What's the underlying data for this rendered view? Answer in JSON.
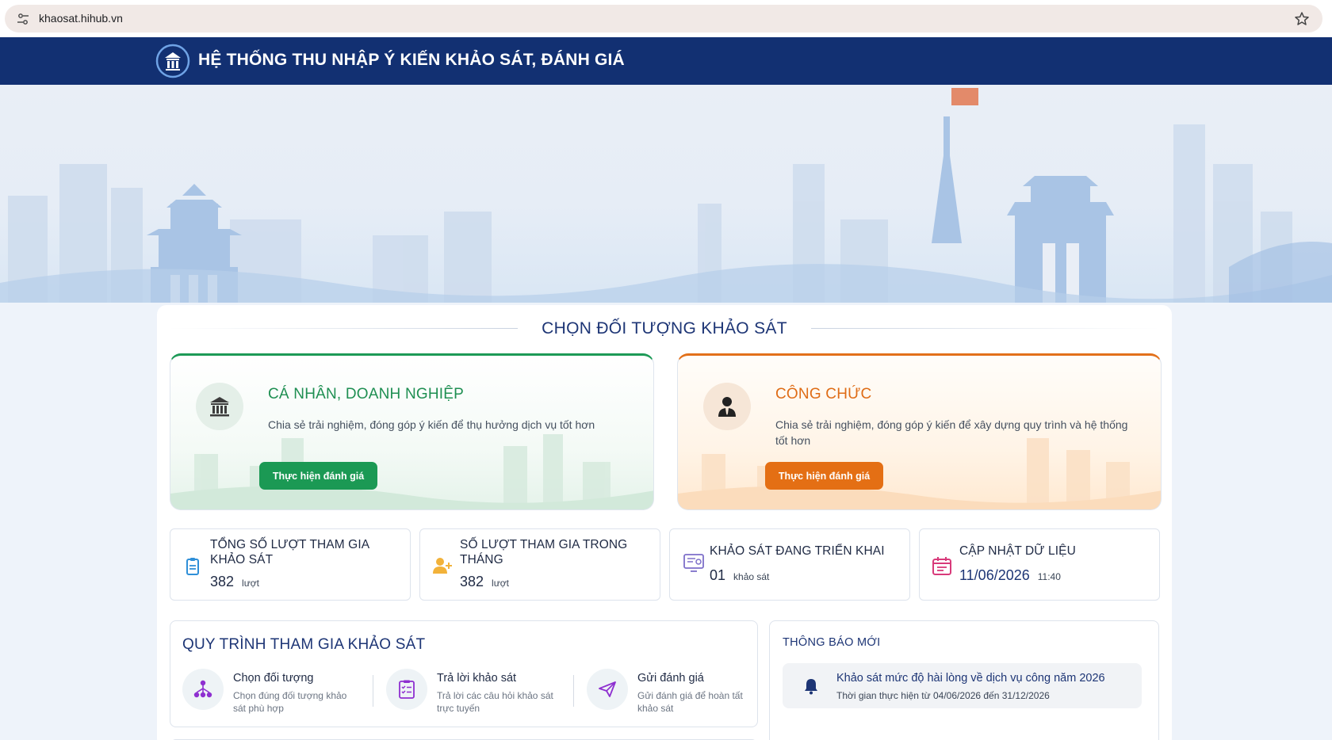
{
  "browser": {
    "url": "khaosat.hihub.vn"
  },
  "header": {
    "title": "HỆ THỐNG THU NHẬP Ý KIẾN KHẢO SÁT, ĐÁNH GIÁ"
  },
  "section": {
    "title": "CHỌN ĐỐI TƯỢNG KHẢO SÁT"
  },
  "targets": [
    {
      "title": "CÁ NHÂN, DOANH NGHIỆP",
      "description": "Chia sẻ trải nghiệm, đóng góp ý kiến để thụ hưởng dịch vụ tốt hơn",
      "button": "Thực hiện đánh giá",
      "icon": "bank-icon",
      "accent": "#1b9954"
    },
    {
      "title": "CÔNG CHỨC",
      "description": "Chia sẻ trải nghiệm, đóng góp ý kiến để xây dựng quy trình và hệ thống tốt hơn",
      "button": "Thực hiện đánh giá",
      "icon": "user-tie-icon",
      "accent": "#e46f14"
    }
  ],
  "stats": [
    {
      "title": "TỔNG SỐ LƯỢT THAM GIA KHẢO SÁT",
      "value": "382",
      "unit": "lượt",
      "icon": "clipboard-icon",
      "color": "#2f8fd8"
    },
    {
      "title": "SỐ LƯỢT THAM GIA TRONG THÁNG",
      "value": "382",
      "unit": "lượt",
      "icon": "user-plus-icon",
      "color": "#f2b23a"
    },
    {
      "title": "KHẢO SÁT ĐANG TRIỂN KHAI",
      "value": "01",
      "unit": "khảo sát",
      "icon": "survey-monitor-icon",
      "color": "#7d6fc9"
    },
    {
      "title": "CẬP NHẬT DỮ LIỆU",
      "value": "11/06/2026",
      "unit": "11:40",
      "icon": "calendar-icon",
      "color": "#d83a7a"
    }
  ],
  "process": {
    "title": "QUY TRÌNH THAM GIA KHẢO SÁT",
    "steps": [
      {
        "title": "Chọn đối tượng",
        "description": "Chọn đúng đối tượng khảo sát phù hợp",
        "icon": "network-icon",
        "color": "#8e2fd0"
      },
      {
        "title": "Trả lời khảo sát",
        "description": "Trả lời các câu hỏi khảo sát trực tuyến",
        "icon": "checklist-icon",
        "color": "#8e2fd0"
      },
      {
        "title": "Gửi đánh giá",
        "description": "Gửi đánh giá để hoàn tất khảo sát",
        "icon": "send-icon",
        "color": "#8e2fd0"
      }
    ]
  },
  "notices": {
    "title": "THÔNG BÁO MỚI",
    "items": [
      {
        "title": "Khảo sát mức độ hài lòng về dịch vụ công năm 2026",
        "subtitle": "Thời gian thực hiện từ 04/06/2026 đến 31/12/2026",
        "icon": "bell-icon"
      }
    ]
  }
}
